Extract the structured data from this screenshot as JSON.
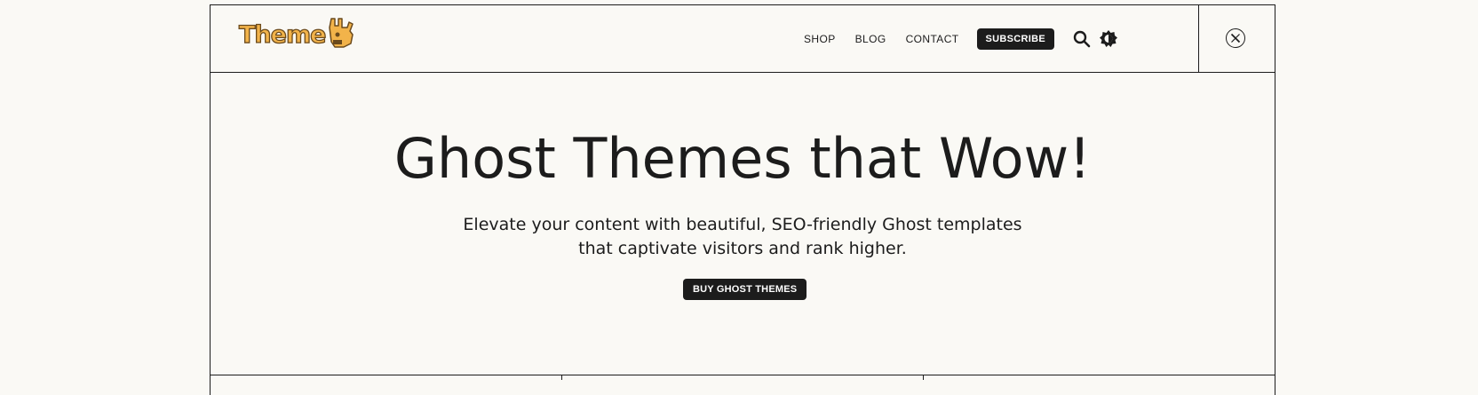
{
  "header": {
    "logo_text": "Theme",
    "nav": [
      {
        "label": "SHOP"
      },
      {
        "label": "BLOG"
      },
      {
        "label": "CONTACT"
      }
    ],
    "subscribe_label": "SUBSCRIBE",
    "icons": [
      "search-icon",
      "theme-toggle-icon",
      "x-social-icon"
    ]
  },
  "hero": {
    "title": "Ghost Themes that Wow!",
    "subtitle_line1": "Elevate your content with beautiful, SEO-friendly Ghost templates",
    "subtitle_line2": "that captivate visitors and rank higher.",
    "cta_label": "BUY GHOST THEMES"
  },
  "colors": {
    "background": "#faf9f5",
    "ink": "#1c1c1c",
    "logo_fill": "#f2b34a"
  }
}
